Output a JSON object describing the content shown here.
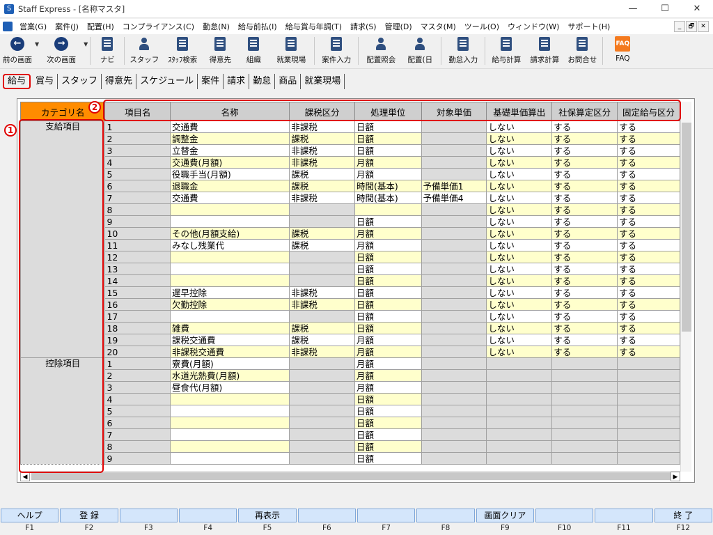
{
  "window": {
    "title": "Staff Express - [名称マスタ]",
    "controls": [
      "—",
      "☐",
      "✕"
    ]
  },
  "menu": [
    "営業(G)",
    "案件(J)",
    "配置(H)",
    "コンプライアンス(C)",
    "勤怠(N)",
    "給与前払(I)",
    "給与賞与年調(T)",
    "請求(S)",
    "管理(D)",
    "マスタ(M)",
    "ツール(O)",
    "ウィンドウ(W)",
    "サポート(H)"
  ],
  "mdi_controls": [
    "_",
    "🗗",
    "✕"
  ],
  "toolbar": {
    "back": "前の画面",
    "next": "次の画面",
    "navi": "ナビ",
    "staff": "スタッフ",
    "staff_search": "ｽﾀｯﾌ検索",
    "customer": "得意先",
    "org": "組織",
    "site": "就業現場",
    "case_input": "案件入力",
    "assign_ref": "配置照会",
    "assign_day": "配置(日",
    "attendance": "勤怠入力",
    "payroll": "給与計算",
    "billing": "請求計算",
    "contact": "お問合せ",
    "faq": "FAQ",
    "faq_icon": "FAQ"
  },
  "tabs": [
    "給与",
    "賞与",
    "スタッフ",
    "得意先",
    "スケジュール",
    "案件",
    "請求",
    "勤怠",
    "商品",
    "就業現場"
  ],
  "grid": {
    "headers": [
      "カテゴリ名",
      "項目名",
      "名称",
      "課税区分",
      "処理単位",
      "対象単価",
      "基礎単価算出",
      "社保算定区分",
      "固定給与区分"
    ],
    "categories": [
      {
        "name": "支給項目",
        "rows": [
          {
            "no": "1",
            "name": "交通費",
            "tax": "非課税",
            "unit": "日額",
            "target": "",
            "base": "しない",
            "social": "する",
            "fixed": "する",
            "c": [
              "g",
              "w",
              "w",
              "w",
              "g",
              "w",
              "w",
              "w"
            ]
          },
          {
            "no": "2",
            "name": "調整金",
            "tax": "課税",
            "unit": "日額",
            "target": "",
            "base": "しない",
            "social": "する",
            "fixed": "する",
            "c": [
              "g",
              "y",
              "y",
              "y",
              "g",
              "y",
              "y",
              "y"
            ]
          },
          {
            "no": "3",
            "name": "立替金",
            "tax": "非課税",
            "unit": "日額",
            "target": "",
            "base": "しない",
            "social": "する",
            "fixed": "する",
            "c": [
              "g",
              "w",
              "w",
              "w",
              "g",
              "w",
              "w",
              "w"
            ]
          },
          {
            "no": "4",
            "name": "交通費(月額)",
            "tax": "非課税",
            "unit": "月額",
            "target": "",
            "base": "しない",
            "social": "する",
            "fixed": "する",
            "c": [
              "g",
              "y",
              "y",
              "y",
              "g",
              "y",
              "y",
              "y"
            ]
          },
          {
            "no": "5",
            "name": "役職手当(月額)",
            "tax": "課税",
            "unit": "月額",
            "target": "",
            "base": "しない",
            "social": "する",
            "fixed": "する",
            "c": [
              "g",
              "w",
              "w",
              "w",
              "g",
              "w",
              "w",
              "w"
            ]
          },
          {
            "no": "6",
            "name": "退職金",
            "tax": "課税",
            "unit": "時間(基本)",
            "target": "予備単価1",
            "base": "しない",
            "social": "する",
            "fixed": "する",
            "c": [
              "g",
              "y",
              "y",
              "y",
              "y",
              "y",
              "y",
              "y"
            ]
          },
          {
            "no": "7",
            "name": "交通費",
            "tax": "非課税",
            "unit": "時間(基本)",
            "target": "予備単価4",
            "base": "しない",
            "social": "する",
            "fixed": "する",
            "c": [
              "g",
              "w",
              "w",
              "w",
              "w",
              "w",
              "w",
              "w"
            ]
          },
          {
            "no": "8",
            "name": "",
            "tax": "",
            "unit": "",
            "target": "",
            "base": "しない",
            "social": "する",
            "fixed": "する",
            "c": [
              "g",
              "y",
              "g",
              "y",
              "g",
              "y",
              "y",
              "y"
            ]
          },
          {
            "no": "9",
            "name": "",
            "tax": "",
            "unit": "日額",
            "target": "",
            "base": "しない",
            "social": "する",
            "fixed": "する",
            "c": [
              "g",
              "w",
              "g",
              "w",
              "g",
              "w",
              "w",
              "w"
            ]
          },
          {
            "no": "10",
            "name": "その他(月額支給)",
            "tax": "課税",
            "unit": "月額",
            "target": "",
            "base": "しない",
            "social": "する",
            "fixed": "する",
            "c": [
              "g",
              "y",
              "y",
              "y",
              "g",
              "y",
              "y",
              "y"
            ]
          },
          {
            "no": "11",
            "name": "みなし残業代",
            "tax": "課税",
            "unit": "月額",
            "target": "",
            "base": "しない",
            "social": "する",
            "fixed": "する",
            "c": [
              "g",
              "w",
              "w",
              "w",
              "g",
              "w",
              "w",
              "w"
            ]
          },
          {
            "no": "12",
            "name": "",
            "tax": "",
            "unit": "日額",
            "target": "",
            "base": "しない",
            "social": "する",
            "fixed": "する",
            "c": [
              "g",
              "y",
              "g",
              "y",
              "g",
              "y",
              "y",
              "y"
            ]
          },
          {
            "no": "13",
            "name": "",
            "tax": "",
            "unit": "日額",
            "target": "",
            "base": "しない",
            "social": "する",
            "fixed": "する",
            "c": [
              "g",
              "w",
              "g",
              "w",
              "g",
              "w",
              "w",
              "w"
            ]
          },
          {
            "no": "14",
            "name": "",
            "tax": "",
            "unit": "日額",
            "target": "",
            "base": "しない",
            "social": "する",
            "fixed": "する",
            "c": [
              "g",
              "y",
              "g",
              "y",
              "g",
              "y",
              "y",
              "y"
            ]
          },
          {
            "no": "15",
            "name": "遅早控除",
            "tax": "非課税",
            "unit": "日額",
            "target": "",
            "base": "しない",
            "social": "する",
            "fixed": "する",
            "c": [
              "g",
              "w",
              "w",
              "w",
              "g",
              "w",
              "w",
              "w"
            ]
          },
          {
            "no": "16",
            "name": "欠勤控除",
            "tax": "非課税",
            "unit": "日額",
            "target": "",
            "base": "しない",
            "social": "する",
            "fixed": "する",
            "c": [
              "g",
              "y",
              "y",
              "y",
              "g",
              "y",
              "y",
              "y"
            ]
          },
          {
            "no": "17",
            "name": "",
            "tax": "",
            "unit": "日額",
            "target": "",
            "base": "しない",
            "social": "する",
            "fixed": "する",
            "c": [
              "g",
              "w",
              "g",
              "w",
              "g",
              "w",
              "w",
              "w"
            ]
          },
          {
            "no": "18",
            "name": "雑費",
            "tax": "課税",
            "unit": "日額",
            "target": "",
            "base": "しない",
            "social": "する",
            "fixed": "する",
            "c": [
              "g",
              "y",
              "y",
              "y",
              "g",
              "y",
              "y",
              "y"
            ]
          },
          {
            "no": "19",
            "name": "課税交通費",
            "tax": "課税",
            "unit": "月額",
            "target": "",
            "base": "しない",
            "social": "する",
            "fixed": "する",
            "c": [
              "g",
              "w",
              "w",
              "w",
              "g",
              "w",
              "w",
              "w"
            ]
          },
          {
            "no": "20",
            "name": "非課税交通費",
            "tax": "非課税",
            "unit": "月額",
            "target": "",
            "base": "しない",
            "social": "する",
            "fixed": "する",
            "c": [
              "g",
              "y",
              "y",
              "y",
              "g",
              "y",
              "y",
              "y"
            ]
          }
        ]
      },
      {
        "name": "控除項目",
        "rows": [
          {
            "no": "1",
            "name": "寮費(月額)",
            "tax": "",
            "unit": "月額",
            "target": "",
            "base": "",
            "social": "",
            "fixed": "",
            "c": [
              "g",
              "w",
              "g",
              "w",
              "g",
              "g",
              "g",
              "g"
            ]
          },
          {
            "no": "2",
            "name": "水道光熱費(月額)",
            "tax": "",
            "unit": "月額",
            "target": "",
            "base": "",
            "social": "",
            "fixed": "",
            "c": [
              "g",
              "y",
              "g",
              "y",
              "g",
              "g",
              "g",
              "g"
            ]
          },
          {
            "no": "3",
            "name": "昼食代(月額)",
            "tax": "",
            "unit": "月額",
            "target": "",
            "base": "",
            "social": "",
            "fixed": "",
            "c": [
              "g",
              "w",
              "g",
              "w",
              "g",
              "g",
              "g",
              "g"
            ]
          },
          {
            "no": "4",
            "name": "",
            "tax": "",
            "unit": "日額",
            "target": "",
            "base": "",
            "social": "",
            "fixed": "",
            "c": [
              "g",
              "y",
              "g",
              "y",
              "g",
              "g",
              "g",
              "g"
            ]
          },
          {
            "no": "5",
            "name": "",
            "tax": "",
            "unit": "日額",
            "target": "",
            "base": "",
            "social": "",
            "fixed": "",
            "c": [
              "g",
              "w",
              "g",
              "w",
              "g",
              "g",
              "g",
              "g"
            ]
          },
          {
            "no": "6",
            "name": "",
            "tax": "",
            "unit": "日額",
            "target": "",
            "base": "",
            "social": "",
            "fixed": "",
            "c": [
              "g",
              "y",
              "g",
              "y",
              "g",
              "g",
              "g",
              "g"
            ]
          },
          {
            "no": "7",
            "name": "",
            "tax": "",
            "unit": "日額",
            "target": "",
            "base": "",
            "social": "",
            "fixed": "",
            "c": [
              "g",
              "w",
              "g",
              "w",
              "g",
              "g",
              "g",
              "g"
            ]
          },
          {
            "no": "8",
            "name": "",
            "tax": "",
            "unit": "日額",
            "target": "",
            "base": "",
            "social": "",
            "fixed": "",
            "c": [
              "g",
              "y",
              "g",
              "y",
              "g",
              "g",
              "g",
              "g"
            ]
          },
          {
            "no": "9",
            "name": "",
            "tax": "",
            "unit": "日額",
            "target": "",
            "base": "",
            "social": "",
            "fixed": "",
            "c": [
              "g",
              "w",
              "g",
              "w",
              "g",
              "g",
              "g",
              "g"
            ]
          }
        ]
      }
    ]
  },
  "annotations": {
    "badge1": "1",
    "badge2": "2"
  },
  "scroll": {
    "left": "◀",
    "right": "▶"
  },
  "fkeys": [
    {
      "label": "ヘルプ",
      "key": "F1"
    },
    {
      "label": "登 録",
      "key": "F2"
    },
    {
      "label": "",
      "key": "F3"
    },
    {
      "label": "",
      "key": "F4"
    },
    {
      "label": "再表示",
      "key": "F5"
    },
    {
      "label": "",
      "key": "F6"
    },
    {
      "label": "",
      "key": "F7"
    },
    {
      "label": "",
      "key": "F8"
    },
    {
      "label": "画面クリア",
      "key": "F9"
    },
    {
      "label": "",
      "key": "F10"
    },
    {
      "label": "",
      "key": "F11"
    },
    {
      "label": "終 了",
      "key": "F12"
    }
  ],
  "colors": {
    "header": "#cfcfcf",
    "category_header": "#ff8c00",
    "stripe": "#ffffcc",
    "readonly": "#dcdcdc",
    "highlight": "#e00000"
  }
}
